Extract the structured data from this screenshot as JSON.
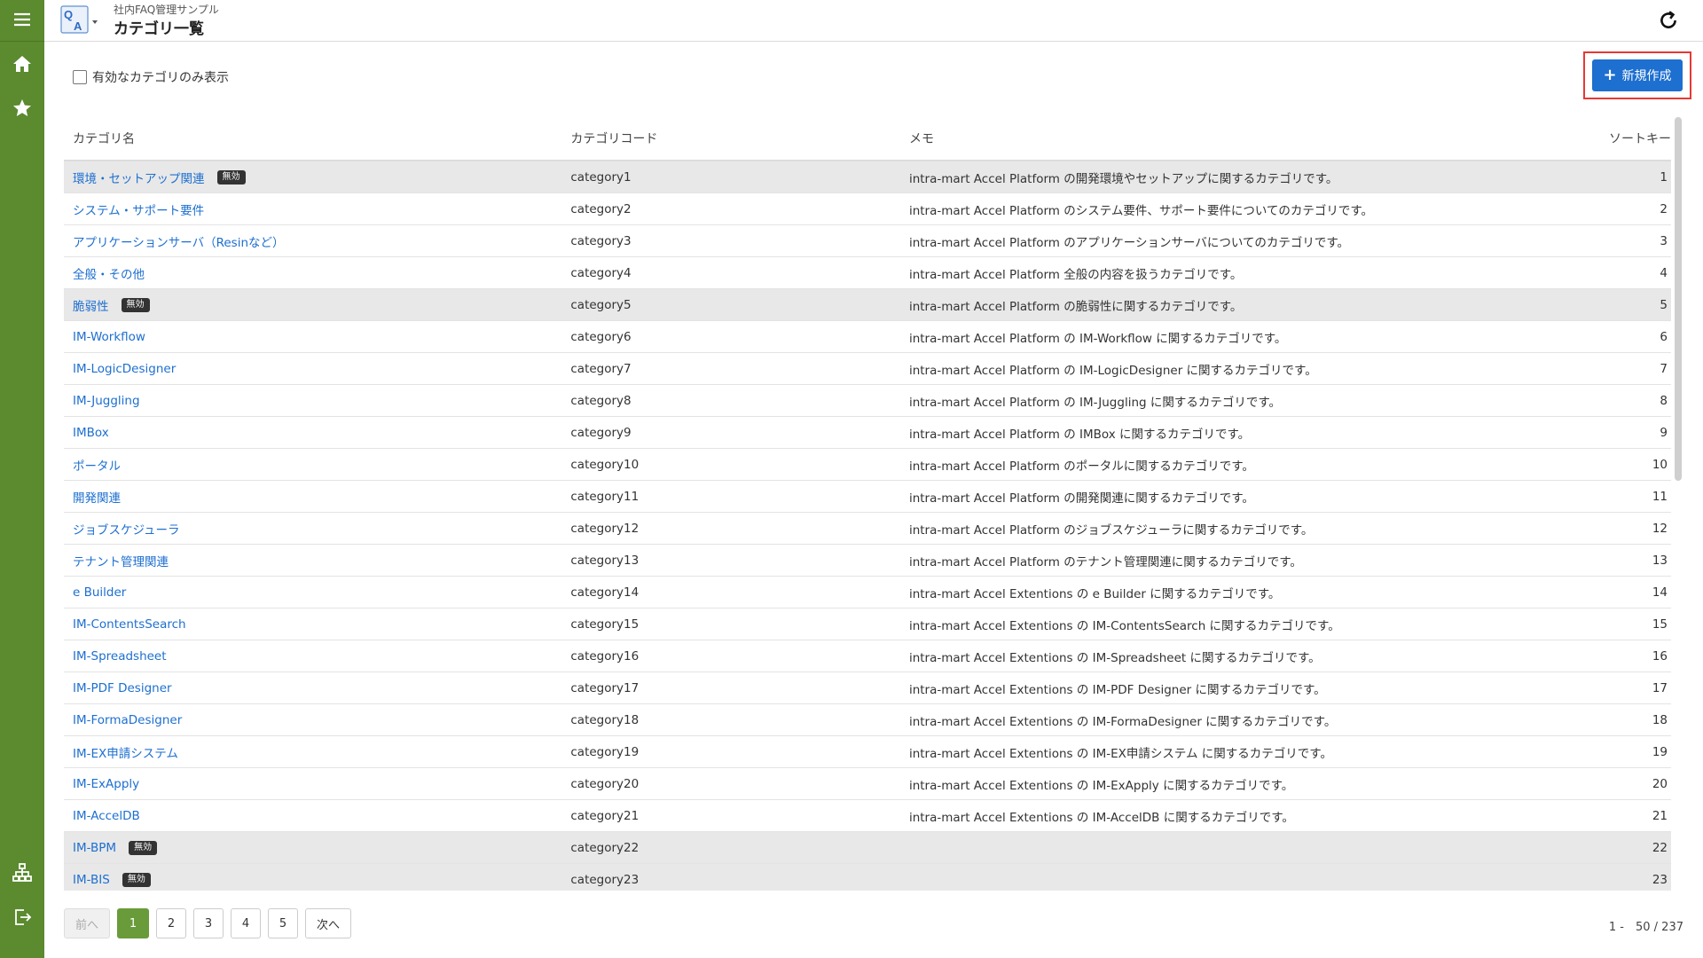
{
  "header": {
    "app_subtitle": "社内FAQ管理サンプル",
    "page_title": "カテゴリ一覧",
    "logo_text_q": "Q",
    "logo_text_a": "A"
  },
  "toolbar": {
    "filter_label": "有効なカテゴリのみ表示",
    "new_button_label": "新規作成"
  },
  "table": {
    "columns": [
      "カテゴリ名",
      "カテゴリコード",
      "メモ",
      "ソートキー"
    ],
    "rows": [
      {
        "name": "環境・セットアップ関連",
        "badge": "無効",
        "code": "category1",
        "memo": "intra-mart Accel Platform の開発環境やセットアップに関するカテゴリです。",
        "sort": "1"
      },
      {
        "name": "システム・サポート要件",
        "badge": "",
        "code": "category2",
        "memo": "intra-mart Accel Platform のシステム要件、サポート要件についてのカテゴリです。",
        "sort": "2"
      },
      {
        "name": "アプリケーションサーバ（Resinなど）",
        "badge": "",
        "code": "category3",
        "memo": "intra-mart Accel Platform のアプリケーションサーバについてのカテゴリです。",
        "sort": "3"
      },
      {
        "name": "全般・その他",
        "badge": "",
        "code": "category4",
        "memo": "intra-mart Accel Platform 全般の内容を扱うカテゴリです。",
        "sort": "4"
      },
      {
        "name": "脆弱性",
        "badge": "無効",
        "code": "category5",
        "memo": "intra-mart Accel Platform の脆弱性に関するカテゴリです。",
        "sort": "5"
      },
      {
        "name": "IM-Workflow",
        "badge": "",
        "code": "category6",
        "memo": "intra-mart Accel Platform の IM-Workflow に関するカテゴリです。",
        "sort": "6"
      },
      {
        "name": "IM-LogicDesigner",
        "badge": "",
        "code": "category7",
        "memo": "intra-mart Accel Platform の IM-LogicDesigner に関するカテゴリです。",
        "sort": "7"
      },
      {
        "name": "IM-Juggling",
        "badge": "",
        "code": "category8",
        "memo": "intra-mart Accel Platform の IM-Juggling に関するカテゴリです。",
        "sort": "8"
      },
      {
        "name": "IMBox",
        "badge": "",
        "code": "category9",
        "memo": "intra-mart Accel Platform の IMBox に関するカテゴリです。",
        "sort": "9"
      },
      {
        "name": "ポータル",
        "badge": "",
        "code": "category10",
        "memo": "intra-mart Accel Platform のポータルに関するカテゴリです。",
        "sort": "10"
      },
      {
        "name": "開発関連",
        "badge": "",
        "code": "category11",
        "memo": "intra-mart Accel Platform の開発関連に関するカテゴリです。",
        "sort": "11"
      },
      {
        "name": "ジョブスケジューラ",
        "badge": "",
        "code": "category12",
        "memo": "intra-mart Accel Platform のジョブスケジューラに関するカテゴリです。",
        "sort": "12"
      },
      {
        "name": "テナント管理関連",
        "badge": "",
        "code": "category13",
        "memo": "intra-mart Accel Platform のテナント管理関連に関するカテゴリです。",
        "sort": "13"
      },
      {
        "name": "e Builder",
        "badge": "",
        "code": "category14",
        "memo": "intra-mart Accel Extentions の e Builder に関するカテゴリです。",
        "sort": "14"
      },
      {
        "name": "IM-ContentsSearch",
        "badge": "",
        "code": "category15",
        "memo": "intra-mart Accel Extentions の IM-ContentsSearch に関するカテゴリです。",
        "sort": "15"
      },
      {
        "name": "IM-Spreadsheet",
        "badge": "",
        "code": "category16",
        "memo": "intra-mart Accel Extentions の IM-Spreadsheet に関するカテゴリです。",
        "sort": "16"
      },
      {
        "name": "IM-PDF Designer",
        "badge": "",
        "code": "category17",
        "memo": "intra-mart Accel Extentions の IM-PDF Designer に関するカテゴリです。",
        "sort": "17"
      },
      {
        "name": "IM-FormaDesigner",
        "badge": "",
        "code": "category18",
        "memo": "intra-mart Accel Extentions の IM-FormaDesigner に関するカテゴリです。",
        "sort": "18"
      },
      {
        "name": "IM-EX申請システム",
        "badge": "",
        "code": "category19",
        "memo": "intra-mart Accel Extentions の IM-EX申請システム に関するカテゴリです。",
        "sort": "19"
      },
      {
        "name": "IM-ExApply",
        "badge": "",
        "code": "category20",
        "memo": "intra-mart Accel Extentions の IM-ExApply に関するカテゴリです。",
        "sort": "20"
      },
      {
        "name": "IM-AccelDB",
        "badge": "",
        "code": "category21",
        "memo": "intra-mart Accel Extentions の IM-AccelDB に関するカテゴリです。",
        "sort": "21"
      },
      {
        "name": "IM-BPM",
        "badge": "無効",
        "code": "category22",
        "memo": "",
        "sort": "22"
      },
      {
        "name": "IM-BIS",
        "badge": "無効",
        "code": "category23",
        "memo": "",
        "sort": "23"
      }
    ]
  },
  "pagination": {
    "prev_label": "前へ",
    "pages": [
      "1",
      "2",
      "3",
      "4",
      "5"
    ],
    "current_page": "1",
    "next_label": "次へ",
    "range_label": "1 -　50 / 237"
  },
  "colors": {
    "rail": "#5b8a2f",
    "link": "#1d6fd0",
    "primary_button": "#1d6fd0",
    "active_page": "#6a9b3a",
    "highlight_outline": "#e53935"
  },
  "icons": {
    "rail_top": [
      "menu-icon",
      "home-icon",
      "star-icon"
    ],
    "rail_bottom": [
      "sitemap-icon",
      "logout-icon"
    ],
    "header_right": "reload-icon"
  }
}
